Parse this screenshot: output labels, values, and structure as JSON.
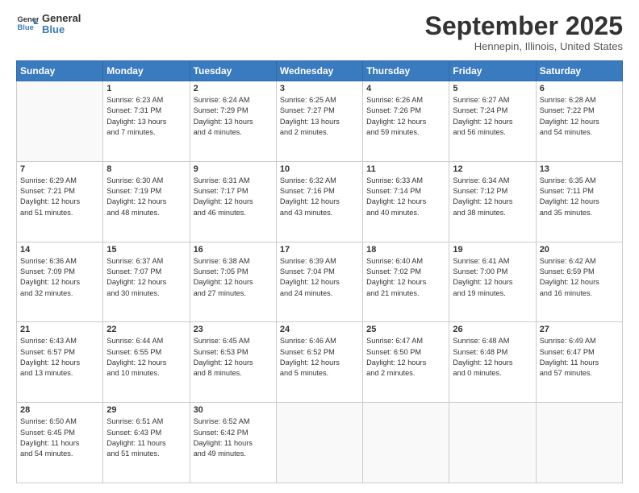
{
  "header": {
    "logo_line1": "General",
    "logo_line2": "Blue",
    "month": "September 2025",
    "location": "Hennepin, Illinois, United States"
  },
  "weekdays": [
    "Sunday",
    "Monday",
    "Tuesday",
    "Wednesday",
    "Thursday",
    "Friday",
    "Saturday"
  ],
  "weeks": [
    [
      {
        "day": "",
        "info": ""
      },
      {
        "day": "1",
        "info": "Sunrise: 6:23 AM\nSunset: 7:31 PM\nDaylight: 13 hours\nand 7 minutes."
      },
      {
        "day": "2",
        "info": "Sunrise: 6:24 AM\nSunset: 7:29 PM\nDaylight: 13 hours\nand 4 minutes."
      },
      {
        "day": "3",
        "info": "Sunrise: 6:25 AM\nSunset: 7:27 PM\nDaylight: 13 hours\nand 2 minutes."
      },
      {
        "day": "4",
        "info": "Sunrise: 6:26 AM\nSunset: 7:26 PM\nDaylight: 12 hours\nand 59 minutes."
      },
      {
        "day": "5",
        "info": "Sunrise: 6:27 AM\nSunset: 7:24 PM\nDaylight: 12 hours\nand 56 minutes."
      },
      {
        "day": "6",
        "info": "Sunrise: 6:28 AM\nSunset: 7:22 PM\nDaylight: 12 hours\nand 54 minutes."
      }
    ],
    [
      {
        "day": "7",
        "info": "Sunrise: 6:29 AM\nSunset: 7:21 PM\nDaylight: 12 hours\nand 51 minutes."
      },
      {
        "day": "8",
        "info": "Sunrise: 6:30 AM\nSunset: 7:19 PM\nDaylight: 12 hours\nand 48 minutes."
      },
      {
        "day": "9",
        "info": "Sunrise: 6:31 AM\nSunset: 7:17 PM\nDaylight: 12 hours\nand 46 minutes."
      },
      {
        "day": "10",
        "info": "Sunrise: 6:32 AM\nSunset: 7:16 PM\nDaylight: 12 hours\nand 43 minutes."
      },
      {
        "day": "11",
        "info": "Sunrise: 6:33 AM\nSunset: 7:14 PM\nDaylight: 12 hours\nand 40 minutes."
      },
      {
        "day": "12",
        "info": "Sunrise: 6:34 AM\nSunset: 7:12 PM\nDaylight: 12 hours\nand 38 minutes."
      },
      {
        "day": "13",
        "info": "Sunrise: 6:35 AM\nSunset: 7:11 PM\nDaylight: 12 hours\nand 35 minutes."
      }
    ],
    [
      {
        "day": "14",
        "info": "Sunrise: 6:36 AM\nSunset: 7:09 PM\nDaylight: 12 hours\nand 32 minutes."
      },
      {
        "day": "15",
        "info": "Sunrise: 6:37 AM\nSunset: 7:07 PM\nDaylight: 12 hours\nand 30 minutes."
      },
      {
        "day": "16",
        "info": "Sunrise: 6:38 AM\nSunset: 7:05 PM\nDaylight: 12 hours\nand 27 minutes."
      },
      {
        "day": "17",
        "info": "Sunrise: 6:39 AM\nSunset: 7:04 PM\nDaylight: 12 hours\nand 24 minutes."
      },
      {
        "day": "18",
        "info": "Sunrise: 6:40 AM\nSunset: 7:02 PM\nDaylight: 12 hours\nand 21 minutes."
      },
      {
        "day": "19",
        "info": "Sunrise: 6:41 AM\nSunset: 7:00 PM\nDaylight: 12 hours\nand 19 minutes."
      },
      {
        "day": "20",
        "info": "Sunrise: 6:42 AM\nSunset: 6:59 PM\nDaylight: 12 hours\nand 16 minutes."
      }
    ],
    [
      {
        "day": "21",
        "info": "Sunrise: 6:43 AM\nSunset: 6:57 PM\nDaylight: 12 hours\nand 13 minutes."
      },
      {
        "day": "22",
        "info": "Sunrise: 6:44 AM\nSunset: 6:55 PM\nDaylight: 12 hours\nand 10 minutes."
      },
      {
        "day": "23",
        "info": "Sunrise: 6:45 AM\nSunset: 6:53 PM\nDaylight: 12 hours\nand 8 minutes."
      },
      {
        "day": "24",
        "info": "Sunrise: 6:46 AM\nSunset: 6:52 PM\nDaylight: 12 hours\nand 5 minutes."
      },
      {
        "day": "25",
        "info": "Sunrise: 6:47 AM\nSunset: 6:50 PM\nDaylight: 12 hours\nand 2 minutes."
      },
      {
        "day": "26",
        "info": "Sunrise: 6:48 AM\nSunset: 6:48 PM\nDaylight: 12 hours\nand 0 minutes."
      },
      {
        "day": "27",
        "info": "Sunrise: 6:49 AM\nSunset: 6:47 PM\nDaylight: 11 hours\nand 57 minutes."
      }
    ],
    [
      {
        "day": "28",
        "info": "Sunrise: 6:50 AM\nSunset: 6:45 PM\nDaylight: 11 hours\nand 54 minutes."
      },
      {
        "day": "29",
        "info": "Sunrise: 6:51 AM\nSunset: 6:43 PM\nDaylight: 11 hours\nand 51 minutes."
      },
      {
        "day": "30",
        "info": "Sunrise: 6:52 AM\nSunset: 6:42 PM\nDaylight: 11 hours\nand 49 minutes."
      },
      {
        "day": "",
        "info": ""
      },
      {
        "day": "",
        "info": ""
      },
      {
        "day": "",
        "info": ""
      },
      {
        "day": "",
        "info": ""
      }
    ]
  ]
}
